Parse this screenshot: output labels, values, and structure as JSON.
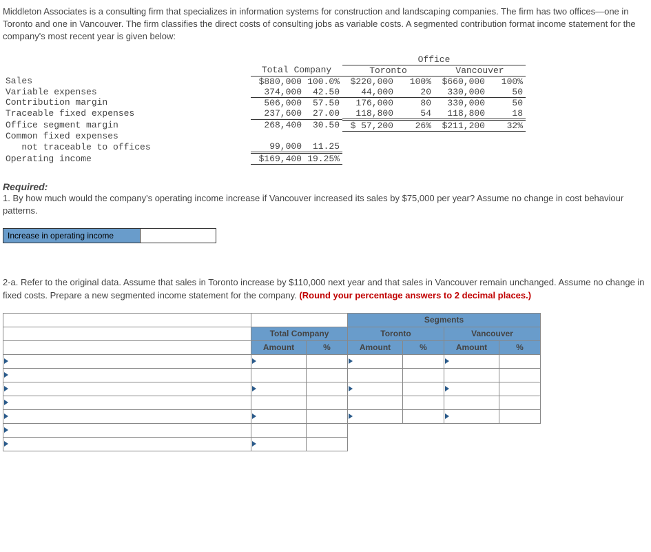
{
  "intro": "Middleton Associates is a consulting firm that specializes in information systems for construction and landscaping companies. The firm has two offices—one in Toronto and one in Vancouver. The firm classifies the direct costs of consulting jobs as variable costs. A segmented contribution format income statement for the company's most recent year is given below:",
  "officeHead": "Office",
  "cols": {
    "total": "Total Company",
    "tor": "Toronto",
    "van": "Vancouver"
  },
  "rows": {
    "sales": {
      "l": "Sales",
      "tc": "$880,000",
      "tcp": "100.0%",
      "to": "$220,000",
      "top": "100%",
      "va": "$660,000",
      "vap": "100%"
    },
    "varexp": {
      "l": "Variable expenses",
      "tc": "374,000",
      "tcp": "42.50",
      "to": "44,000",
      "top": "20",
      "va": "330,000",
      "vap": "50"
    },
    "cm": {
      "l": "Contribution margin",
      "tc": "506,000",
      "tcp": "57.50",
      "to": "176,000",
      "top": "80",
      "va": "330,000",
      "vap": "50"
    },
    "tfe": {
      "l": "Traceable fixed expenses",
      "tc": "237,600",
      "tcp": "27.00",
      "to": "118,800",
      "top": "54",
      "va": "118,800",
      "vap": "18"
    },
    "osm": {
      "l": "Office segment margin",
      "tc": "268,400",
      "tcp": "30.50",
      "to": "$ 57,200",
      "top": "26%",
      "va": "$211,200",
      "vap": "32%"
    },
    "cfe1": {
      "l": "Common fixed expenses"
    },
    "cfe2": {
      "l": "   not traceable to offices",
      "tc": "99,000",
      "tcp": "11.25"
    },
    "oi": {
      "l": "Operating income",
      "tc": "$169,400",
      "tcp": "19.25%"
    }
  },
  "reqHead": "Required:",
  "q1": "1. By how much would the company's operating income increase if Vancouver increased its sales by $75,000 per year? Assume no change in cost behaviour patterns.",
  "q1Label": "Increase in operating income",
  "q2a": "2-a. Refer to the original data. Assume that sales in Toronto increase by $110,000 next year and that sales in Vancouver remain unchanged. Assume no change in fixed costs. Prepare a new segmented income statement for the company. ",
  "q2aRed": "(Round your percentage answers to 2 decimal places.)",
  "wheaders": {
    "segments": "Segments",
    "totalCompany": "Total Company",
    "toronto": "Toronto",
    "vancouver": "Vancouver",
    "amount": "Amount",
    "pct": "%"
  }
}
